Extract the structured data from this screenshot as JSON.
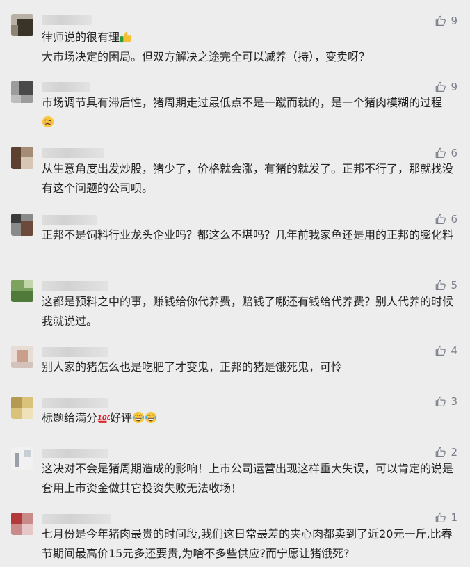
{
  "comments": [
    {
      "likes": "9",
      "text": "律师说的很有理",
      "emoji_after": "thumbs-up-icon",
      "text2": "大市场决定的困局。但双方解决之途完全可以减养（持），变卖呀？"
    },
    {
      "likes": "9",
      "text": "市场调节具有滞后性，猪周期走过最低点不是一蹴而就的，是一个猪肉模糊的过程",
      "emoji_end": "woozy-face-icon"
    },
    {
      "likes": "6",
      "text": "从生意角度出发炒股，猪少了，价格就会涨，有猪的就发了。正邦不行了，那就找没有这个问题的公司呗。"
    },
    {
      "likes": "6",
      "text": "正邦不是饲料行业龙头企业吗？都这么不堪吗？几年前我家鱼还是用的正邦的膨化料"
    },
    {
      "likes": "5",
      "text": "这都是预料之中的事，赚钱给你代养费，赔钱了哪还有钱给代养费？别人代养的时候我就说过。"
    },
    {
      "likes": "4",
      "text": "别人家的猪怎么也是吃肥了才变鬼，正邦的猪是饿死鬼，可怜"
    },
    {
      "likes": "3",
      "text": "标题给满分",
      "text_after": "好评",
      "emojis": [
        "hundred-points-icon",
        "grinning-tears-icon",
        "grinning-tears-icon"
      ]
    },
    {
      "likes": "2",
      "text": "这决对不会是猪周期造成的影响！上市公司运营出现这样重大失误，可以肯定的说是套用上市资金做其它投资失败无法收场！"
    },
    {
      "likes": "1",
      "text": "七月份是今年猪肉最贵的时间段,我们这日常最差的夹心肉都卖到了近20元一斤,比春节期间最高价15元多还要贵,为啥不多些供应?而宁愿让猪饿死?"
    }
  ],
  "colors": {
    "background": "#ededed",
    "text": "#222222",
    "like": "#7a7f8a"
  }
}
